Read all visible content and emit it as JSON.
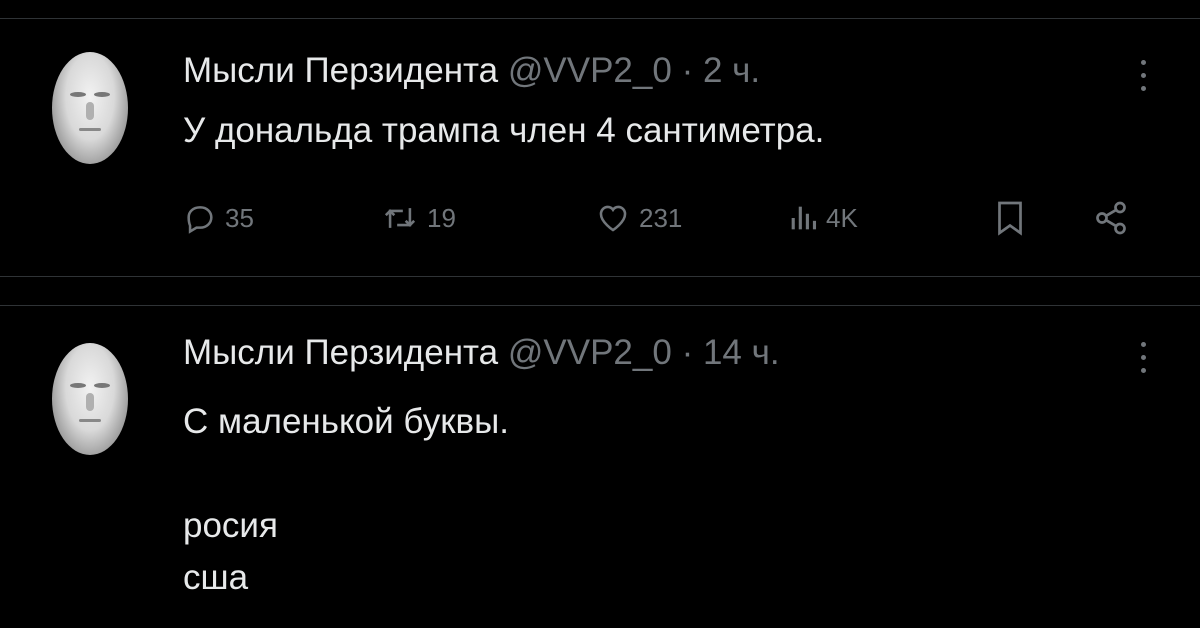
{
  "tweets": [
    {
      "author_name": "Мысли Перзидента",
      "handle": "@VVP2_0",
      "time": "· 2 ч.",
      "text": "У дональда трампа член 4 сантиметра.",
      "stats": {
        "replies": "35",
        "reposts": "19",
        "likes": "231",
        "views": "4K"
      }
    },
    {
      "author_name": "Мысли Перзидента",
      "handle": "@VVP2_0",
      "time": "· 14 ч.",
      "text": "С маленькой буквы.\n\nросия\nсша"
    }
  ],
  "icons": {
    "reply": "reply-icon",
    "repost": "repost-icon",
    "like": "heart-icon",
    "views": "views-icon",
    "bookmark": "bookmark-icon",
    "share": "share-icon",
    "more": "more-icon"
  },
  "colors": {
    "background": "#000000",
    "text": "#e7e9ea",
    "muted": "#71767b",
    "divider": "#2f3336"
  }
}
